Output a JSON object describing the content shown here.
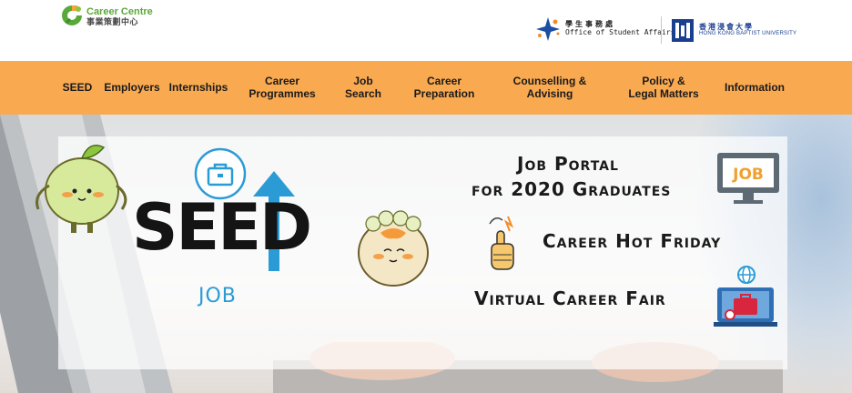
{
  "header": {
    "career_centre": {
      "name_en": "Career Centre",
      "name_zh": "事業策劃中心"
    },
    "osa": {
      "name_zh": "學生事務處",
      "name_en": "Office of Student Affairs"
    },
    "hkbu": {
      "name_zh": "香港浸會大學",
      "name_en": "HONG KONG BAPTIST UNIVERSITY"
    }
  },
  "nav": {
    "items": [
      {
        "label": "SEED"
      },
      {
        "label": "Employers"
      },
      {
        "label": "Internships"
      },
      {
        "label": "Career Programmes"
      },
      {
        "label": "Job Search"
      },
      {
        "label": "Career Preparation"
      },
      {
        "label": "Counselling & Advising"
      },
      {
        "label": "Policy & Legal Matters"
      },
      {
        "label": "Information"
      }
    ]
  },
  "banner": {
    "seed_logo": {
      "word": "SEED",
      "sub": "JOB"
    },
    "job_portal": {
      "line1": "Job Portal",
      "line2": "for 2020 Graduates"
    },
    "monitor_label": "JOB",
    "hot_friday": "Career Hot Friday",
    "virtual_fair": "Virtual Career Fair"
  },
  "colors": {
    "nav_bg": "#f9a950",
    "brand_green": "#5ba83a",
    "hkbu_blue": "#1b3f8f",
    "seed_blue": "#2b9bd6"
  },
  "icons": [
    "career-centre-logo-icon",
    "osa-star-icon",
    "hkbu-crest-icon",
    "briefcase-icon",
    "up-arrow-icon",
    "job-monitor-icon",
    "finger-icon",
    "laptop-briefcase-icon",
    "mascot-icon"
  ]
}
